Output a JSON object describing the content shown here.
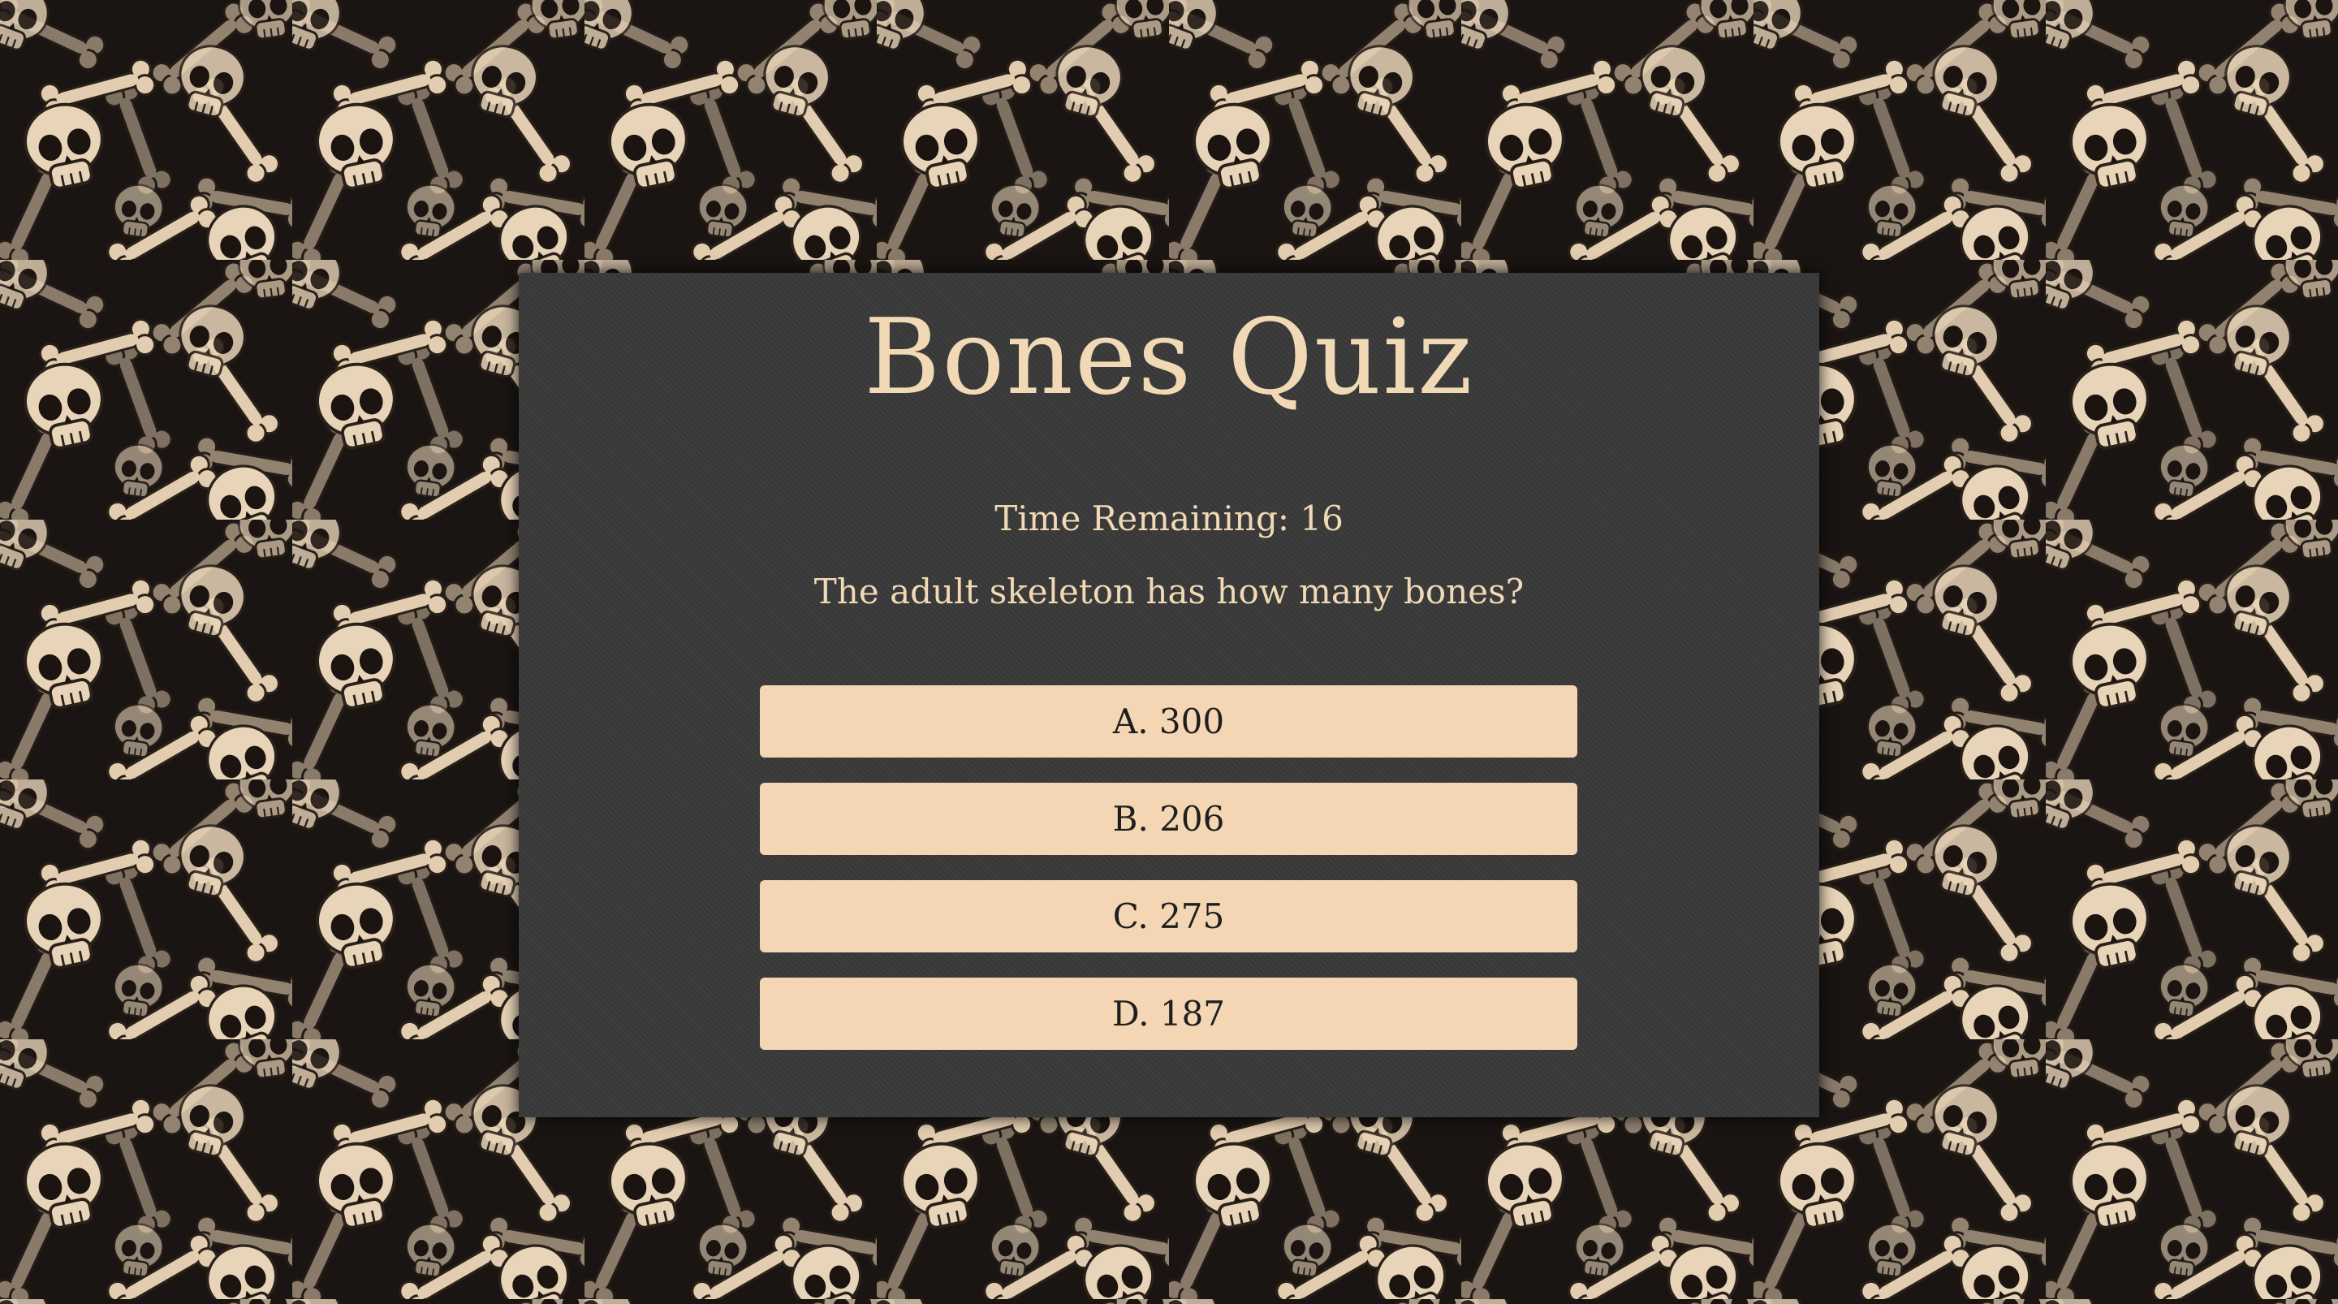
{
  "page": {
    "background_color": "#1a1512",
    "bone_color": "#e3cdb0",
    "bone_shadow": "#8c7a64"
  },
  "quiz": {
    "title": "Bones Quiz",
    "timer_text": "Time Remaining: 16",
    "question": "The adult skeleton has how many bones?",
    "answers": [
      {
        "label": "A. 300"
      },
      {
        "label": "B. 206"
      },
      {
        "label": "C. 275"
      },
      {
        "label": "D. 187"
      }
    ],
    "panel_color": "#3a3a3a",
    "text_color": "#f1d9b5",
    "button_color": "#f4d6b4"
  }
}
